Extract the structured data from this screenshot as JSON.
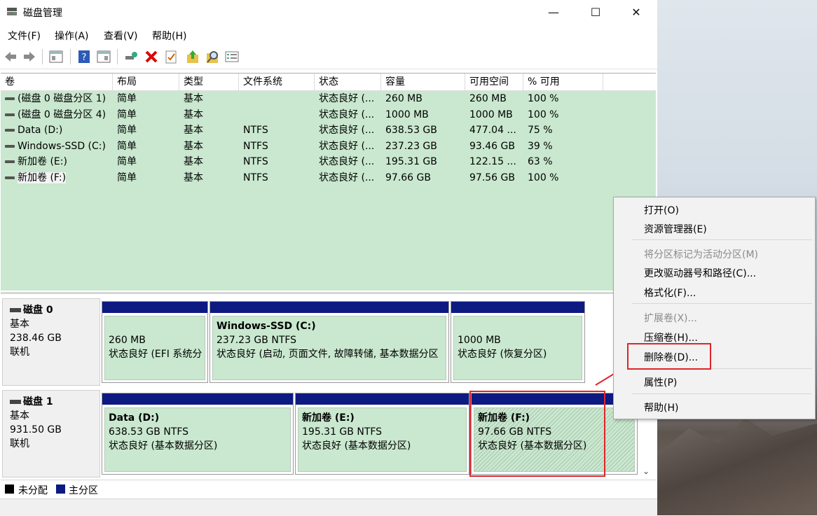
{
  "window": {
    "title": "磁盘管理",
    "min": "—",
    "max": "☐",
    "close": "✕"
  },
  "menu": [
    "文件(F)",
    "操作(A)",
    "查看(V)",
    "帮助(H)"
  ],
  "toolbar": [
    "back-icon",
    "forward-icon",
    "console-icon",
    "help-icon",
    "console2-icon",
    "connect-icon",
    "delete-icon",
    "checklist-icon",
    "up-folder-icon",
    "search-icon",
    "properties-icon"
  ],
  "columns": [
    "卷",
    "布局",
    "类型",
    "文件系统",
    "状态",
    "容量",
    "可用空间",
    "% 可用"
  ],
  "volumes": [
    [
      "(磁盘 0 磁盘分区 1)",
      "简单",
      "基本",
      "",
      "状态良好 (...",
      "260 MB",
      "260 MB",
      "100 %"
    ],
    [
      "(磁盘 0 磁盘分区 4)",
      "简单",
      "基本",
      "",
      "状态良好 (...",
      "1000 MB",
      "1000 MB",
      "100 %"
    ],
    [
      "Data (D:)",
      "简单",
      "基本",
      "NTFS",
      "状态良好 (...",
      "638.53 GB",
      "477.04 ...",
      "75 %"
    ],
    [
      "Windows-SSD (C:)",
      "简单",
      "基本",
      "NTFS",
      "状态良好 (...",
      "237.23 GB",
      "93.46 GB",
      "39 %"
    ],
    [
      "新加卷 (E:)",
      "简单",
      "基本",
      "NTFS",
      "状态良好 (...",
      "195.31 GB",
      "122.15 ...",
      "63 %"
    ],
    [
      "新加卷 (F:)",
      "简单",
      "基本",
      "NTFS",
      "状态良好 (...",
      "97.66 GB",
      "97.56 GB",
      "100 %"
    ]
  ],
  "disks": [
    {
      "name": "磁盘 0",
      "type": "基本",
      "size": "238.46 GB",
      "state": "联机",
      "partitions": [
        {
          "name": "",
          "size": "260 MB",
          "status": "状态良好 (EFI 系统分"
        },
        {
          "name": "Windows-SSD  (C:)",
          "size": "237.23 GB NTFS",
          "status": "状态良好 (启动, 页面文件, 故障转储, 基本数据分区"
        },
        {
          "name": "",
          "size": "1000 MB",
          "status": "状态良好 (恢复分区)"
        }
      ]
    },
    {
      "name": "磁盘 1",
      "type": "基本",
      "size": "931.50 GB",
      "state": "联机",
      "partitions": [
        {
          "name": "Data  (D:)",
          "size": "638.53 GB NTFS",
          "status": "状态良好 (基本数据分区)"
        },
        {
          "name": "新加卷  (E:)",
          "size": "195.31 GB NTFS",
          "status": "状态良好 (基本数据分区)"
        },
        {
          "name": "新加卷  (F:)",
          "size": "97.66 GB NTFS",
          "status": "状态良好 (基本数据分区)"
        }
      ]
    }
  ],
  "legend": {
    "unallocated": "未分配",
    "primary": "主分区"
  },
  "context_menu": {
    "open": "打开(O)",
    "explorer": "资源管理器(E)",
    "mark_active": "将分区标记为活动分区(M)",
    "change_letter": "更改驱动器号和路径(C)...",
    "format": "格式化(F)...",
    "extend": "扩展卷(X)...",
    "shrink": "压缩卷(H)...",
    "delete": "删除卷(D)...",
    "properties": "属性(P)",
    "help": "帮助(H)"
  },
  "colors": {
    "partition_bar": "#0c1a82",
    "healthy_fill": "#c9e8cf",
    "highlight": "#e0242c"
  }
}
